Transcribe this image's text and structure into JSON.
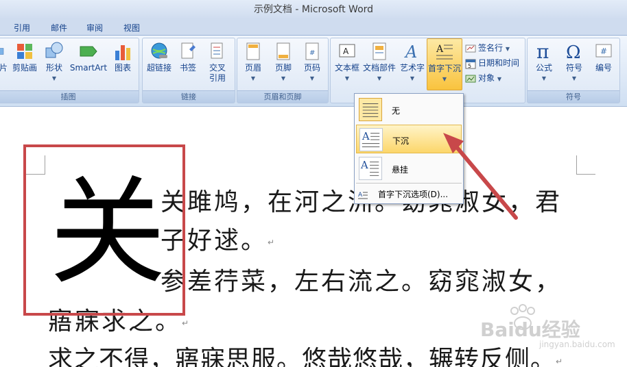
{
  "window": {
    "title": "示例文档 - Microsoft Word"
  },
  "tabs": [
    "引用",
    "邮件",
    "审阅",
    "视图"
  ],
  "ribbon": {
    "group_illustrations": {
      "caption": "插图",
      "buttons": [
        "片",
        "剪贴画",
        "形状",
        "SmartArt",
        "图表"
      ]
    },
    "group_links": {
      "caption": "链接",
      "buttons": [
        "超链接",
        "书签",
        "交叉引用"
      ]
    },
    "group_header_footer": {
      "caption": "页眉和页脚",
      "buttons": [
        "页眉",
        "页脚",
        "页码"
      ]
    },
    "group_text": {
      "buttons": [
        "文本框",
        "文档部件",
        "艺术字",
        "首字下沉"
      ],
      "small_buttons": [
        "签名行",
        "日期和时间",
        "对象"
      ]
    },
    "group_symbols": {
      "caption": "符号",
      "buttons": [
        "公式",
        "符号",
        "编号"
      ]
    }
  },
  "dropcap_menu": {
    "items": [
      "无",
      "下沉",
      "悬挂"
    ],
    "options": "首字下沉选项(D)..."
  },
  "document": {
    "dropcap_char": "关",
    "lines": [
      "关雎鸠，在河之洲。窈窕淑女，君",
      "子好逑。",
      "参差荇菜，左右流之。窈窕淑女，",
      "寤寐求之。",
      "求之不得，寤寐思服。悠哉悠哉，辗转反侧。"
    ]
  },
  "watermark": {
    "brand": "Baidu经验",
    "url": "jingyan.baidu.com"
  },
  "colors": {
    "accent": "#f9c33e",
    "annotation": "#c8484a",
    "ribbon": "#dde8f6"
  }
}
